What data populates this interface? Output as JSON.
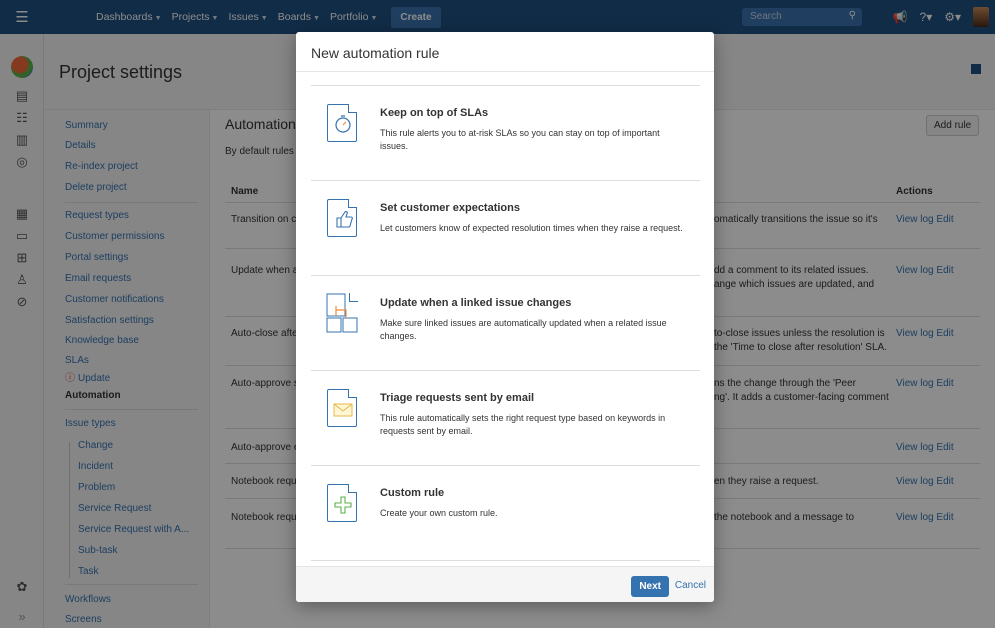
{
  "topbar": {
    "nav": [
      {
        "label": "Dashboards"
      },
      {
        "label": "Projects"
      },
      {
        "label": "Issues"
      },
      {
        "label": "Boards"
      },
      {
        "label": "Portfolio"
      }
    ],
    "create_label": "Create",
    "search_placeholder": "Search",
    "icons": [
      "menu-icon",
      "search-icon",
      "notifications-icon",
      "help-icon",
      "settings-icon",
      "avatar"
    ]
  },
  "page": {
    "title": "Project settings"
  },
  "sidebar": {
    "groups": [
      [
        "Summary",
        "Details",
        "Re-index project",
        "Delete project"
      ],
      [
        "Request types",
        "Customer permissions",
        "Portal settings",
        "Email requests",
        "Customer notifications",
        "Satisfaction settings",
        "Knowledge base",
        "SLAs"
      ]
    ],
    "update_label": "Update",
    "active_label": "Automation",
    "issue_types_label": "Issue types",
    "issue_types": [
      "Change",
      "Incident",
      "Problem",
      "Service Request",
      "Service Request with A...",
      "Sub-task",
      "Task"
    ],
    "workflows_label": "Workflows",
    "screens_label": "Screens"
  },
  "main": {
    "title": "Automation",
    "description": "By default rules r",
    "add_rule_label": "Add rule",
    "col_name": "Name",
    "col_actions": "Actions",
    "rows": [
      {
        "name": "Transition on c",
        "desc": "omatically transitions the issue so it's",
        "desc2": ""
      },
      {
        "name": "Update when a",
        "desc": "dd a comment to its related issues.",
        "desc2": "ange which issues are updated, and"
      },
      {
        "name": "Auto-close afte",
        "desc": "to-close issues unless the resolution is",
        "desc2": "the 'Time to close after resolution' SLA."
      },
      {
        "name": "Auto-approve s",
        "desc": "ns the change through the 'Peer",
        "desc2": "ng'. It adds a customer-facing comment"
      },
      {
        "name": "Auto-approve e",
        "desc": "",
        "desc2": ""
      },
      {
        "name": "Notebook requ",
        "desc": "en they raise a request.",
        "desc2": ""
      },
      {
        "name": "Notebook requ",
        "desc": "the notebook and a message to",
        "desc2": ""
      }
    ],
    "view_log_label": "View log",
    "edit_label": "Edit"
  },
  "dialog": {
    "title": "New automation rule",
    "options": [
      {
        "title": "Keep on top of SLAs",
        "desc": "This rule alerts you to at-risk SLAs so you can stay on top of important issues.",
        "icon": "stopwatch-icon"
      },
      {
        "title": "Set customer expectations",
        "desc": "Let customers know of expected resolution times when they raise a request.",
        "icon": "thumbs-up-icon"
      },
      {
        "title": "Update when a linked issue changes",
        "desc": "Make sure linked issues are automatically updated when a related issue changes.",
        "icon": "linked-issues-icon"
      },
      {
        "title": "Triage requests sent by email",
        "desc": "This rule automatically sets the right request type based on keywords in requests sent by email.",
        "icon": "envelope-icon"
      },
      {
        "title": "Custom rule",
        "desc": "Create your own custom rule.",
        "icon": "plus-icon"
      }
    ],
    "next_label": "Next",
    "cancel_label": "Cancel"
  },
  "colors": {
    "topbar": "#205081",
    "link": "#3572b0",
    "accent_orange": "#f08c3b",
    "accent_green": "#5bb24a",
    "warning": "#d04437"
  }
}
